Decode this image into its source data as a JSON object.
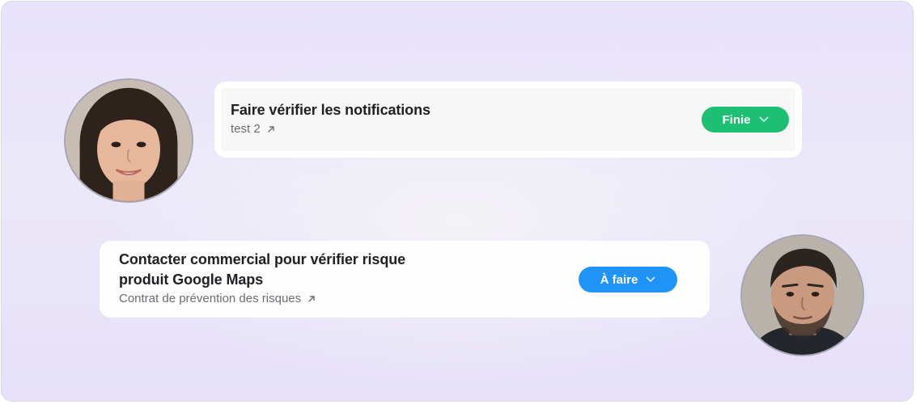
{
  "tasks": [
    {
      "title": "Faire vérifier les notifications",
      "link_text": "test 2",
      "status": "Finie",
      "status_color": "#1dbf73",
      "assignee_avatar": "woman-portrait"
    },
    {
      "title": "Contacter commercial pour vérifier risque produit Google Maps",
      "link_text": "Contrat de prévention des risques",
      "status": "À faire",
      "status_color": "#1f94f6",
      "assignee_avatar": "man-portrait"
    }
  ],
  "icons": {
    "link": "arrow-up-right-icon",
    "dropdown": "chevron-down-icon"
  },
  "colors": {
    "background_top": "#e8e2fc",
    "card": "#ffffff",
    "title_text": "#1f2023",
    "secondary_text": "#6b6d72"
  }
}
